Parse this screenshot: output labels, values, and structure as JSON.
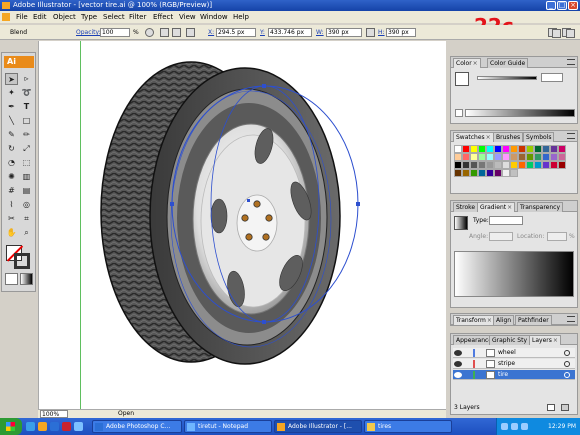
{
  "window": {
    "title": "Adobe Illustrator - [vector tire.ai @ 100% (RGB/Preview)]"
  },
  "menu": [
    "File",
    "Edit",
    "Object",
    "Type",
    "Select",
    "Filter",
    "Effect",
    "View",
    "Window",
    "Help"
  ],
  "overlay_label": "22c",
  "control_bar": {
    "mode": "Blend",
    "opacity_label": "Opacity:",
    "opacity_value": "100",
    "opacity_unit": "%",
    "x_label": "X:",
    "x_value": "294.5 px",
    "y_label": "Y:",
    "y_value": "433.746 px",
    "w_label": "W:",
    "w_value": "390 px",
    "h_label": "H:",
    "h_value": "390 px"
  },
  "tools": {
    "logo": "Ai",
    "type_tool": "T"
  },
  "status_bar": {
    "zoom": "100%",
    "state": "Open"
  },
  "panels": {
    "color": {
      "tabs": [
        "Color",
        "Color Guide"
      ]
    },
    "swatches": {
      "tabs": [
        "Swatches",
        "Brushes",
        "Symbols"
      ],
      "colors": [
        "#ffffff",
        "#ff0000",
        "#ffff00",
        "#00ff00",
        "#00ffff",
        "#0000ff",
        "#ff00ff",
        "#ff9900",
        "#cc3300",
        "#99cc00",
        "#006633",
        "#336699",
        "#663399",
        "#cc0066",
        "#ffcc99",
        "#ff6666",
        "#ffff99",
        "#99ff99",
        "#99ffff",
        "#9999ff",
        "#ff99ff",
        "#cc9966",
        "#996633",
        "#669900",
        "#339966",
        "#3366cc",
        "#9966cc",
        "#cc6699",
        "#000000",
        "#333333",
        "#555555",
        "#777777",
        "#999999",
        "#bbbbbb",
        "#dddddd",
        "#ffcc00",
        "#ff6600",
        "#00cc66",
        "#0099cc",
        "#6633cc",
        "#cc0033",
        "#990000",
        "#663300",
        "#996600",
        "#339900",
        "#006699",
        "#330099",
        "#660066",
        "#f0f0f0",
        "#c0c0c0"
      ]
    },
    "gradient": {
      "tabs": [
        "Stroke",
        "Gradient",
        "Transparency"
      ],
      "type_label": "Type:",
      "angle_label": "Angle:",
      "location_label": "Location:",
      "location_unit": "%"
    },
    "transform": {
      "tabs": [
        "Transform",
        "Align",
        "Pathfinder"
      ]
    },
    "layers": {
      "tabs": [
        "Appearance",
        "Graphic Sty",
        "Layers"
      ],
      "items": [
        {
          "name": "wheel",
          "color": "#4f7be0",
          "selected": false
        },
        {
          "name": "stripe",
          "color": "#e04f4f",
          "selected": false
        },
        {
          "name": "tire",
          "color": "#3fb04f",
          "selected": true
        }
      ],
      "count": "3 Layers"
    }
  },
  "taskbar": {
    "tasks": [
      {
        "label": "Adobe Photoshop C...",
        "color": "#2b6fd6"
      },
      {
        "label": "tiretut - Notepad",
        "color": "#6fb6ff"
      },
      {
        "label": "Adobe Illustrator - [...",
        "color": "#f5a623"
      },
      {
        "label": "tires",
        "color": "#f2c94c"
      }
    ],
    "clock": "12:29 PM"
  }
}
